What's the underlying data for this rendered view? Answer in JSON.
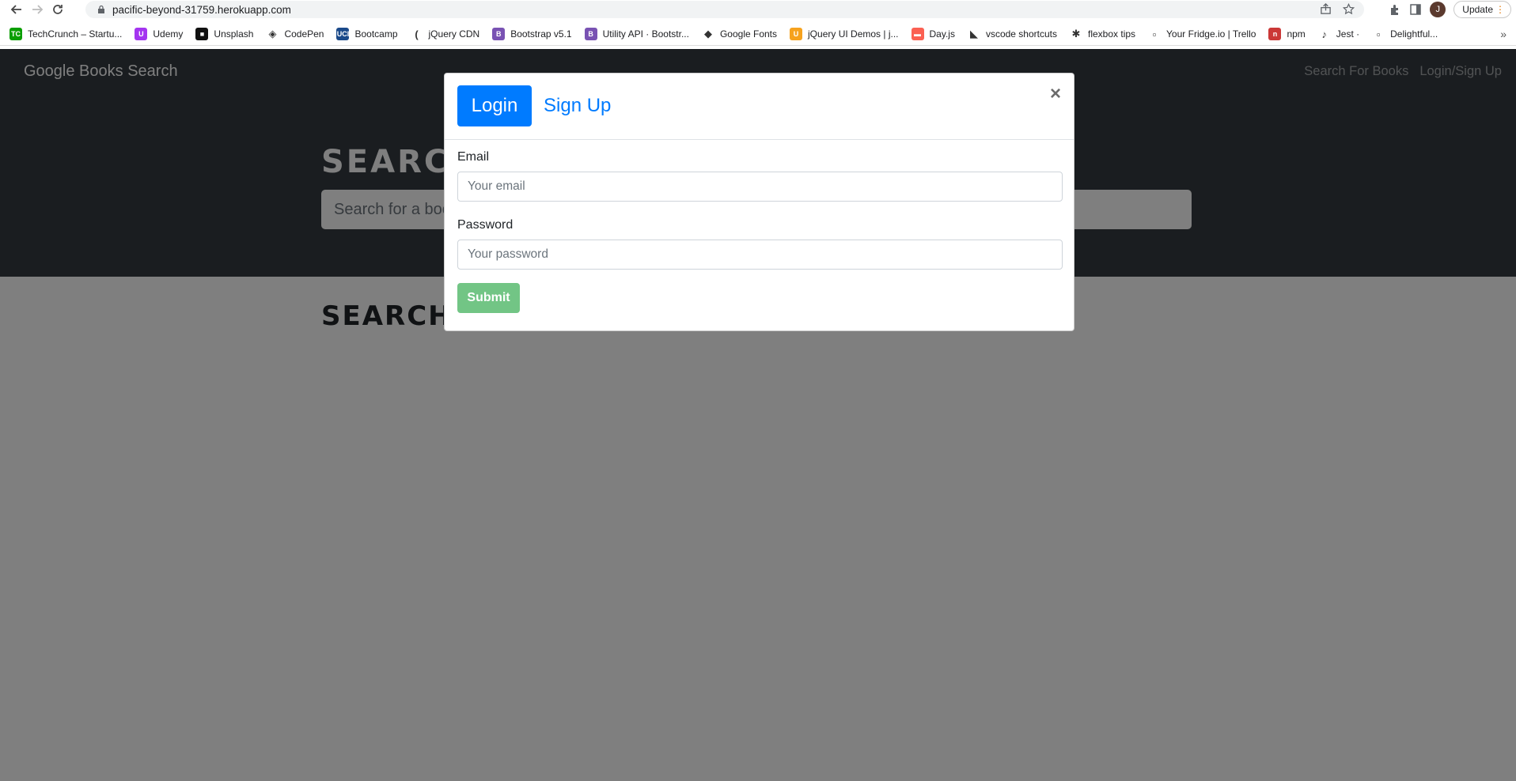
{
  "browser": {
    "url": "pacific-beyond-31759.herokuapp.com",
    "avatar_letter": "J",
    "update_label": "Update",
    "bookmarks": [
      {
        "label": "TechCrunch – Startu...",
        "icon": "TC",
        "color": "#0a9e01"
      },
      {
        "label": "Udemy",
        "icon": "U",
        "color": "#a435f0"
      },
      {
        "label": "Unsplash",
        "icon": "■",
        "color": "#111111"
      },
      {
        "label": "CodePen",
        "icon": "◈",
        "color": "#ffffff"
      },
      {
        "label": "Bootcamp",
        "icon": "UCI",
        "color": "#1b4a8a"
      },
      {
        "label": "jQuery CDN",
        "icon": "(",
        "color": "#ffffff"
      },
      {
        "label": "Bootstrap v5.1",
        "icon": "B",
        "color": "#7952b3"
      },
      {
        "label": "Utility API · Bootstr...",
        "icon": "B",
        "color": "#7952b3"
      },
      {
        "label": "Google Fonts",
        "icon": "◆",
        "color": "#ffffff"
      },
      {
        "label": "jQuery UI Demos | j...",
        "icon": "U",
        "color": "#f6a21d"
      },
      {
        "label": "Day.js",
        "icon": "▬",
        "color": "#fb6052"
      },
      {
        "label": "vscode shortcuts",
        "icon": "◣",
        "color": "#ffffff"
      },
      {
        "label": "flexbox tips",
        "icon": "✱",
        "color": "#ffffff"
      },
      {
        "label": "Your Fridge.io | Trello",
        "icon": "▫",
        "color": "#ffffff"
      },
      {
        "label": "npm",
        "icon": "n",
        "color": "#cb3837"
      },
      {
        "label": "Jest ·",
        "icon": "♪",
        "color": "#ffffff"
      },
      {
        "label": "Delightful...",
        "icon": "▫",
        "color": "#ffffff"
      }
    ]
  },
  "page": {
    "brand": "Google Books Search",
    "nav": {
      "search": "Search For Books",
      "login": "Login/Sign Up"
    },
    "hero_title": "SEARCH FOR BOOKS!",
    "search_placeholder": "Search for a book",
    "results_title": "SEARCH FOR A BOOK TO BEGIN"
  },
  "modal": {
    "tab_login": "Login",
    "tab_signup": "Sign Up",
    "close": "×",
    "email_label": "Email",
    "email_placeholder": "Your email",
    "password_label": "Password",
    "password_placeholder": "Your password",
    "submit": "Submit"
  },
  "colors": {
    "navbar_bg": "#343a40",
    "primary": "#007bff",
    "success": "#28a745"
  }
}
